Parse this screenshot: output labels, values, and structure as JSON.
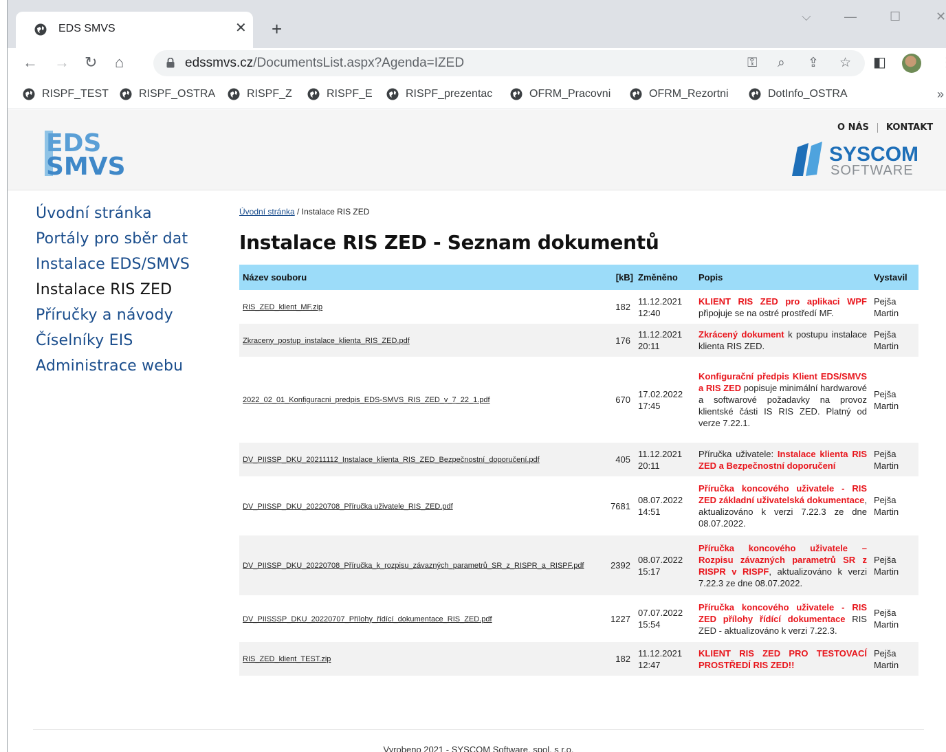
{
  "browser": {
    "tab_title": "EDS SMVS",
    "tab_close": "✕",
    "new_tab": "+",
    "url_host": "edssmvs.cz",
    "url_path": "/DocumentsList.aspx?Agenda=IZED",
    "bookmarks": [
      "RISPF_TEST",
      "RISPF_OSTRA",
      "RISPF_Z",
      "RISPF_E",
      "RISPF_prezentac",
      "OFRM_Pracovni",
      "OFRM_Rezortni",
      "DotInfo_OSTRA"
    ],
    "bookmarks_more": "»"
  },
  "header": {
    "links": [
      "O NÁS",
      "KONTAKT"
    ],
    "eds_logo_text": [
      "EDS",
      "SMVS"
    ],
    "syscom_logo_text": [
      "SYSCOM",
      "SOFTWARE"
    ]
  },
  "nav": {
    "items": [
      "Úvodní stránka",
      "Portály pro sběr dat",
      "Instalace EDS/SMVS",
      "Instalace RIS ZED",
      "Příručky a návody",
      "Číselníky EIS",
      "Administrace webu"
    ]
  },
  "breadcrumb": {
    "home": "Úvodní stránka",
    "separator": " / ",
    "current": "Instalace RIS ZED"
  },
  "page_title": "Instalace RIS ZED - Seznam dokumentů",
  "table": {
    "headers": [
      "Název souboru",
      "[kB]",
      "Změněno",
      "Popis",
      "Vystavil"
    ],
    "rows": [
      {
        "file": "RIS_ZED_klient_MF.zip",
        "size": "182",
        "date": "11.12.2021",
        "time": "12:40",
        "desc_red": "KLIENT RIS ZED pro aplikaci WPF",
        "desc_plain": " připojuje se na ostré prostředí MF.",
        "author": "Pejša Martin"
      },
      {
        "file": "Zkraceny_postup_instalace_klienta_RIS_ZED.pdf",
        "size": "176",
        "date": "11.12.2021",
        "time": "20:11",
        "desc_red": "Zkrácený dokument",
        "desc_plain": " k postupu instalace klienta RIS ZED.",
        "author": "Pejša Martin"
      },
      {
        "file": "2022_02_01_Konfiguracni_predpis_EDS-SMVS_RIS_ZED_v_7_22_1.pdf",
        "size": "670",
        "date": "17.02.2022",
        "time": "17:45",
        "desc_red": "Konfigurační předpis Klient EDS/SMVS a RIS ZED",
        "desc_plain": " popisuje minimální hardwarové a softwarové požadavky na provoz klientské části IS RIS ZED. Platný od verze 7.22.1.",
        "author": "Pejša Martin"
      },
      {
        "file": "DV_PIISSP_DKU_20211112_Instalace_klienta_RIS_ZED_Bezpečnostní_doporučení.pdf",
        "size": "405",
        "date": "11.12.2021",
        "time": "20:11",
        "desc_prefix": "Příručka uživatele: ",
        "desc_red": "Instalace klienta RIS ZED a Bezpečnostní doporučení",
        "desc_plain": "",
        "author": "Pejša Martin"
      },
      {
        "file": "DV_PIISSP_DKU_20220708_Příručka uživatele_RIS_ZED.pdf",
        "size": "7681",
        "date": "08.07.2022",
        "time": "14:51",
        "desc_red": "Příručka koncového uživatele - RIS ZED základní uživatelská dokumentace",
        "desc_plain": ", aktualizováno k verzi 7.22.3 ze dne 08.07.2022.",
        "author": "Pejša Martin"
      },
      {
        "file": "DV_PIISSP_DKU_20220708_Příručka_k_rozpisu_závazných_parametrů_SR_z_RISPR_a_RISPF.pdf",
        "size": "2392",
        "date": "08.07.2022",
        "time": "15:17",
        "desc_red": "Příručka koncového uživatele – Rozpisu závazných parametrů SR z RISPR v RISPF",
        "desc_plain": ", aktualizováno k verzi 7.22.3 ze dne 08.07.2022.",
        "author": "Pejša Martin"
      },
      {
        "file": "DV_PIISSSP_DKU_20220707_Přílohy_řídící_dokumentace_RIS_ZED.pdf",
        "size": "1227",
        "date": "07.07.2022",
        "time": "15:54",
        "desc_red": "Příručka koncového uživatele - RIS ZED přílohy řídící dokumentace",
        "desc_plain": " RIS ZED - aktualizováno k verzi 7.22.3.",
        "author": "Pejša Martin"
      },
      {
        "file": "RIS_ZED_klient_TEST.zip",
        "size": "182",
        "date": "11.12.2021",
        "time": "12:47",
        "desc_red": "KLIENT RIS ZED PRO TESTOVACÍ PROSTŘEDÍ RIS ZED!!",
        "desc_plain": "",
        "author": "Pejša Martin"
      }
    ]
  },
  "footer": {
    "text": "Vyrobeno 2021 - SYSCOM Software, spol. s r.o."
  },
  "colors": {
    "nav_link": "#1a4d8c",
    "table_header": "#9cdcf9",
    "highlight_red": "#e8141b"
  }
}
